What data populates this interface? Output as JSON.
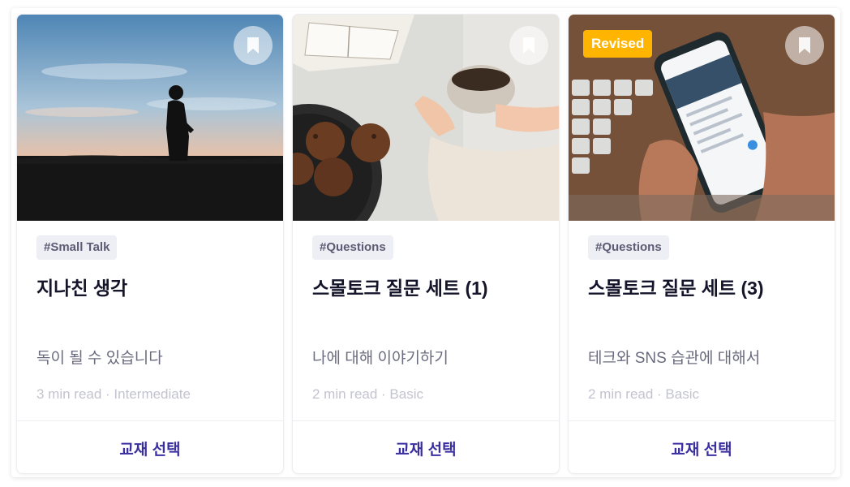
{
  "cards": [
    {
      "tag": "#Small Talk",
      "title": "지나친 생각",
      "subtitle": "독이 될 수 있습니다",
      "meta": "3 min read · Intermediate",
      "button_label": "교재 선택",
      "badge": "",
      "image_icon": "silhouette-sunset-photo"
    },
    {
      "tag": "#Questions",
      "title": "스몰토크 질문 세트 (1)",
      "subtitle": "나에 대해 이야기하기",
      "meta": "2 min read · Basic",
      "button_label": "교재 선택",
      "badge": "",
      "image_icon": "coffee-book-muffins-photo"
    },
    {
      "tag": "#Questions",
      "title": "스몰토크 질문 세트 (3)",
      "subtitle": "테크와 SNS 습관에 대해서",
      "meta": "2 min read · Basic",
      "button_label": "교재 선택",
      "badge": "Revised",
      "image_icon": "phone-keyboard-photo"
    }
  ],
  "colors": {
    "accent": "#3a2fa0",
    "badge": "#ffb400",
    "tag_bg": "#eeeef5"
  }
}
